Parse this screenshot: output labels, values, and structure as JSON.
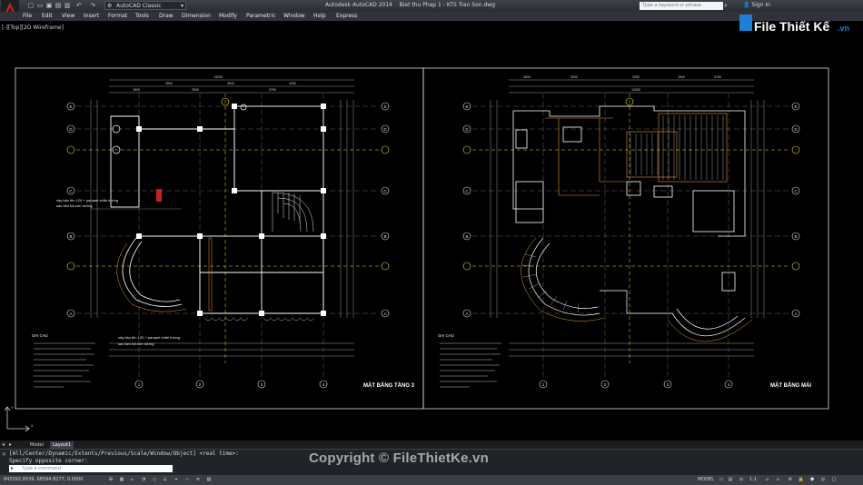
{
  "titlebar": {
    "workspace": "AutoCAD Classic",
    "app_title": "Autodesk AutoCAD 2014",
    "file_title": "Biet thu Phap 1 - KTS Tran Son.dwg",
    "search_placeholder": "Type a keyword or phrase",
    "sign_in": "Sign In"
  },
  "menu": [
    "File",
    "Edit",
    "View",
    "Insert",
    "Format",
    "Tools",
    "Draw",
    "Dimension",
    "Modify",
    "Parametric",
    "Window",
    "Help",
    "Express"
  ],
  "brand": {
    "text": "File Thiết Kế",
    "suffix": ".vn"
  },
  "viewport": {
    "label": "[-][Top][2D Wireframe]"
  },
  "drawing": {
    "left_plan": {
      "title": "MẶT BẰNG TẦNG 3",
      "note1": "xây bậu lên 120 + parapet chắn tường",
      "note1b": "sau làm bả sơn tường",
      "note2": "xây bậu lên 120 + parapet chắn tường",
      "note2b": "sau làm bả sơn tường",
      "notes_title": "GHI CHÚ",
      "axes_rows": [
        "E",
        "D",
        "C",
        "B",
        "A"
      ],
      "axes_cols": [
        "1",
        "2",
        "3",
        "4"
      ],
      "dims": [
        "13250",
        "3500",
        "3500",
        "3250",
        "1500",
        "2500",
        "3750"
      ]
    },
    "right_plan": {
      "title": "MẶT BẰNG MÁI",
      "notes_title": "GHI CHÚ",
      "axes_rows": [
        "E",
        "D",
        "C",
        "B",
        "A"
      ],
      "axes_cols": [
        "1",
        "2",
        "3",
        "4"
      ],
      "dims": [
        "2600",
        "3500",
        "3250",
        "1500",
        "3750",
        "13250"
      ]
    }
  },
  "tabs": {
    "model": "Model",
    "layout1": "Layout1"
  },
  "command": {
    "line1": "[All/Center/Dynamic/Extents/Previous/Scale/Window/Object] <real time>:",
    "line2": "Specify opposite corner:",
    "placeholder": "Type a command"
  },
  "status": {
    "coords": "843392.9539, 68594.8277, 0.0000",
    "model": "MODEL",
    "scale": "1:1"
  },
  "watermark": "Copyright © FileThietKe.vn",
  "colors": {
    "title_bg": "#33373d",
    "menu_bg": "#30343a",
    "canvas": "#000000",
    "accent_red": "#c8201a",
    "brand_blue": "#1e7fd6"
  }
}
